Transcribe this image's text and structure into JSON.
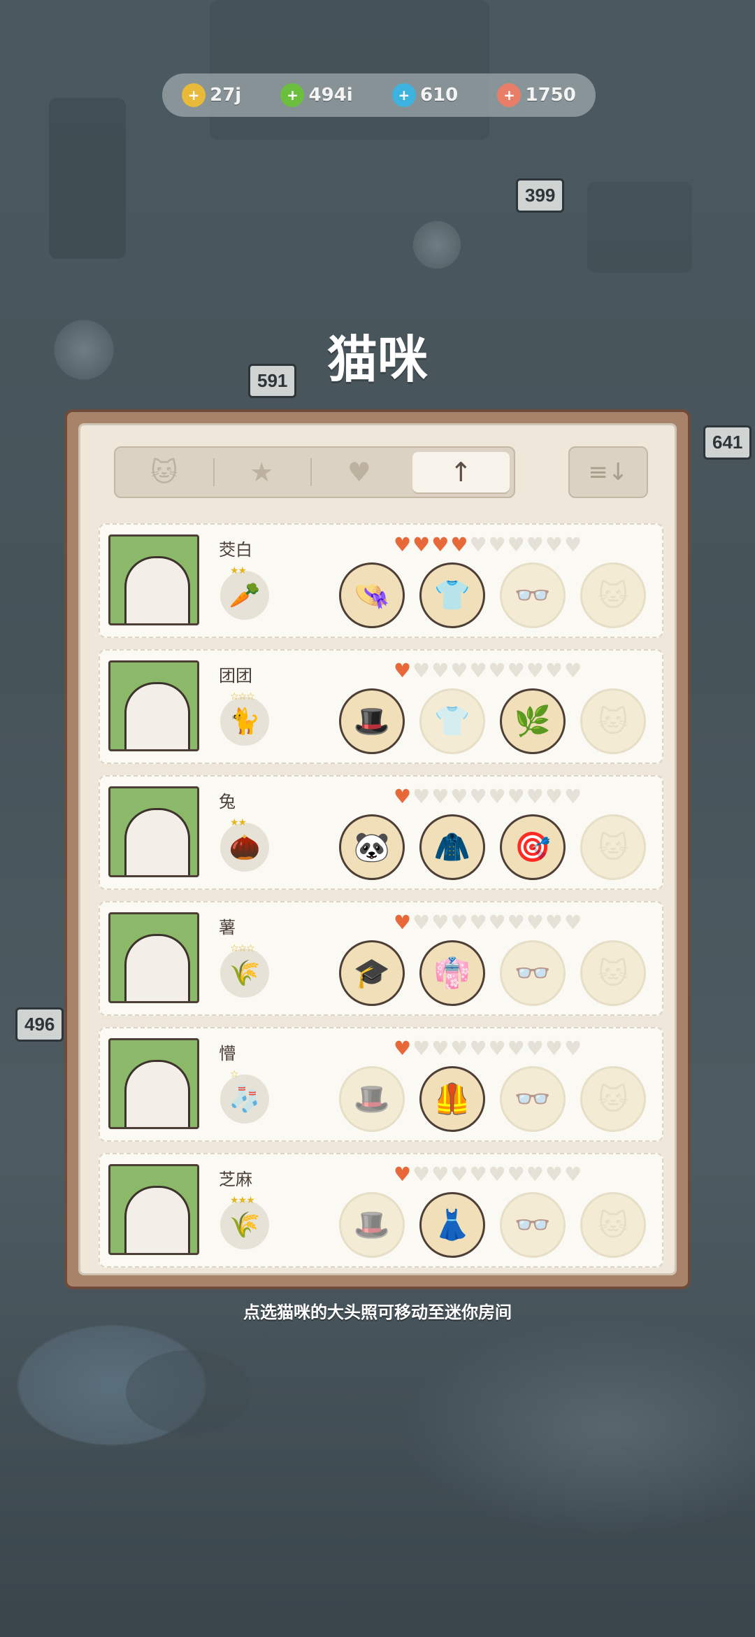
{
  "currency": [
    {
      "icon": "coin-icon",
      "value": "27j",
      "color": "#e9b93a"
    },
    {
      "icon": "lightning-icon",
      "value": "494i",
      "color": "#6cbf3e"
    },
    {
      "icon": "diamond-icon",
      "value": "610",
      "color": "#3fb3e0"
    },
    {
      "icon": "cookie-icon",
      "value": "1750",
      "color": "#e97e68"
    }
  ],
  "title": "猫咪",
  "tabs": [
    {
      "icon": "cat-face-icon",
      "glyph": "🐱"
    },
    {
      "icon": "star-icon",
      "glyph": "★"
    },
    {
      "icon": "heart-icon",
      "glyph": "♥"
    },
    {
      "icon": "arrow-up-icon",
      "glyph": "↑",
      "active": true
    }
  ],
  "sort_icon": "≡↓",
  "cats": [
    {
      "name": "茭白",
      "badge": "🥕",
      "badge_stars": "★★",
      "hearts": 4,
      "items": [
        {
          "g": "👒",
          "owned": true
        },
        {
          "g": "👕",
          "owned": true
        },
        {
          "g": "👓",
          "owned": false
        },
        {
          "g": "🐱",
          "owned": false
        }
      ]
    },
    {
      "name": "团团",
      "badge": "🐈",
      "badge_stars": "☆☆☆",
      "hearts": 1,
      "items": [
        {
          "g": "🎩",
          "owned": true
        },
        {
          "g": "👕",
          "owned": false
        },
        {
          "g": "🌿",
          "owned": true
        },
        {
          "g": "🐱",
          "owned": false
        }
      ]
    },
    {
      "name": "兔",
      "badge": "🌰",
      "badge_stars": "★★",
      "hearts": 1,
      "items": [
        {
          "g": "🐼",
          "owned": true
        },
        {
          "g": "🧥",
          "owned": true
        },
        {
          "g": "🎯",
          "owned": true
        },
        {
          "g": "🐱",
          "owned": false
        }
      ]
    },
    {
      "name": "薯",
      "badge": "🌾",
      "badge_stars": "☆☆☆",
      "hearts": 1,
      "items": [
        {
          "g": "🎓",
          "owned": true
        },
        {
          "g": "👘",
          "owned": true
        },
        {
          "g": "👓",
          "owned": false
        },
        {
          "g": "🐱",
          "owned": false
        }
      ]
    },
    {
      "name": "懵",
      "badge": "🧦",
      "badge_stars": "☆",
      "hearts": 1,
      "items": [
        {
          "g": "🎩",
          "owned": false
        },
        {
          "g": "🦺",
          "owned": true
        },
        {
          "g": "👓",
          "owned": false
        },
        {
          "g": "🐱",
          "owned": false
        }
      ]
    },
    {
      "name": "芝麻",
      "badge": "🌾",
      "badge_stars": "★★★",
      "hearts": 1,
      "items": [
        {
          "g": "🎩",
          "owned": false
        },
        {
          "g": "👗",
          "owned": true
        },
        {
          "g": "👓",
          "owned": false
        },
        {
          "g": "🐱",
          "owned": false
        }
      ]
    }
  ],
  "hint": "点选猫咪的大头照可移动至迷你房间",
  "background_signs": [
    "399",
    "591",
    "641",
    "496"
  ]
}
